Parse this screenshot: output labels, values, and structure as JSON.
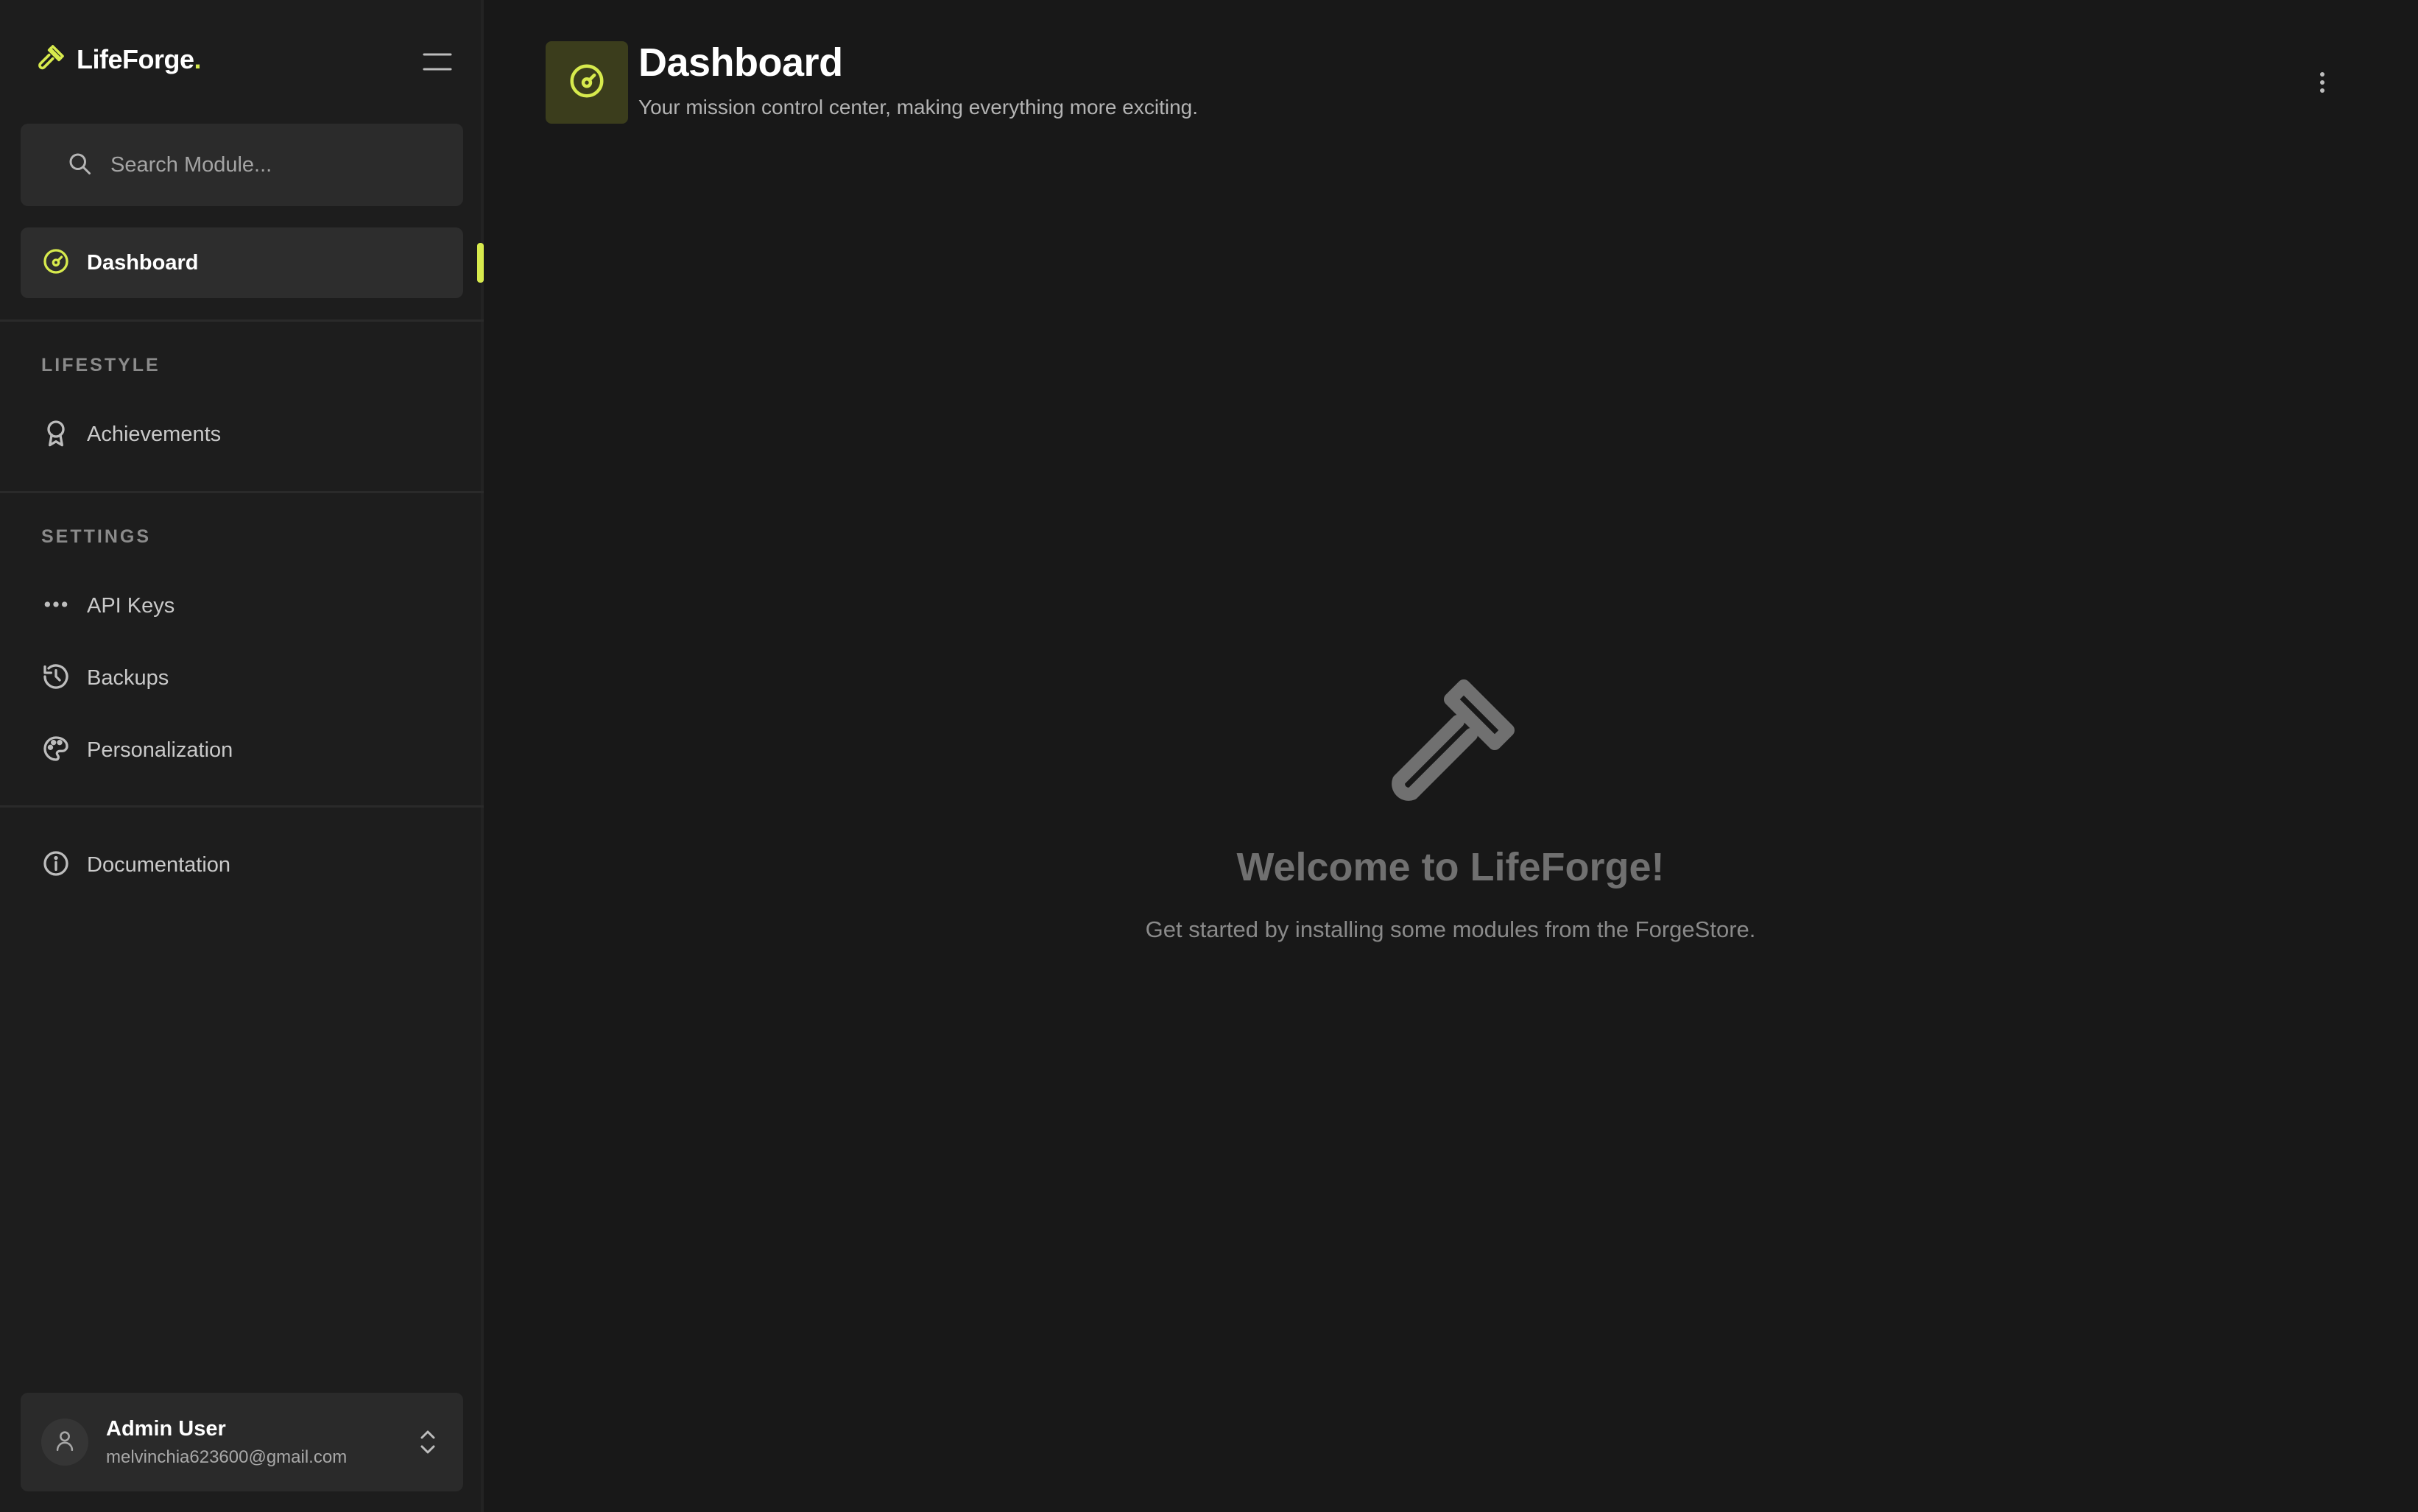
{
  "sidebar": {
    "brand": {
      "name": "LifeForge",
      "dot": "."
    },
    "search": {
      "placeholder": "Search Module..."
    },
    "dashboard_item": {
      "label": "Dashboard"
    },
    "sections": [
      {
        "title": "LIFESTYLE",
        "items": [
          {
            "label": "Achievements",
            "icon": "award-icon"
          }
        ]
      },
      {
        "title": "SETTINGS",
        "items": [
          {
            "label": "API Keys",
            "icon": "dots-icon"
          },
          {
            "label": "Backups",
            "icon": "history-icon"
          },
          {
            "label": "Personalization",
            "icon": "palette-icon"
          }
        ]
      }
    ],
    "documentation": {
      "label": "Documentation",
      "icon": "info-icon"
    },
    "user": {
      "name": "Admin User",
      "email": "melvinchia623600@gmail.com"
    }
  },
  "header": {
    "title": "Dashboard",
    "subtitle": "Your mission control center, making everything more exciting."
  },
  "empty_state": {
    "title": "Welcome to LifeForge!",
    "text": "Get started by installing some modules from the ForgeStore."
  },
  "colors": {
    "accent": "#d7ea4d",
    "background": "#181818",
    "sidebar": "#1d1d1d"
  }
}
